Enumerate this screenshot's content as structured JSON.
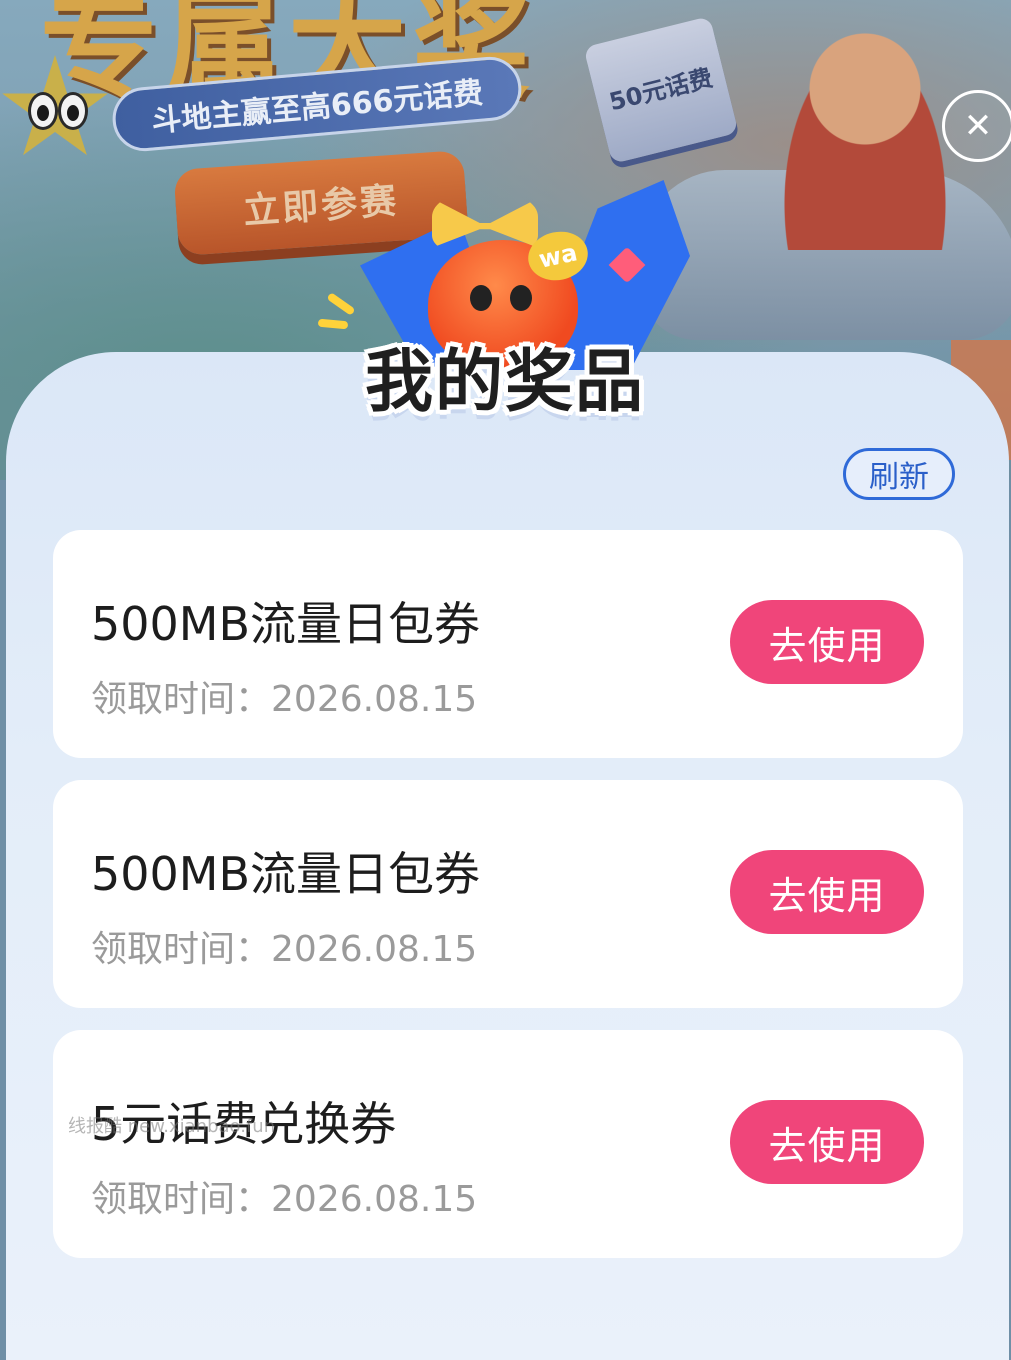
{
  "banner": {
    "headline": "专属大奖",
    "subtitle": "斗地主赢至高666元话费",
    "cta_label": "立即参赛",
    "ticket_label": "50元话费"
  },
  "modal": {
    "title": "我的奖品",
    "mascot_badge": "wa",
    "refresh_label": "刷新",
    "close_icon": "close-icon",
    "prizes": [
      {
        "name": "500MB流量日包券",
        "time_label": "领取时间：",
        "time_value": "2026.08.15",
        "action_label": "去使用"
      },
      {
        "name": "500MB流量日包券",
        "time_label": "领取时间：",
        "time_value": "2026.08.15",
        "action_label": "去使用"
      },
      {
        "name": "5元话费兑换券",
        "time_label": "领取时间：",
        "time_value": "2026.08.15",
        "action_label": "去使用"
      }
    ]
  },
  "watermark": "线报酷 new.xianbao.fun",
  "colors": {
    "accent_button": "#f0457a",
    "refresh_border": "#2f6ad8",
    "panel_bg": "#dbe7f7"
  }
}
